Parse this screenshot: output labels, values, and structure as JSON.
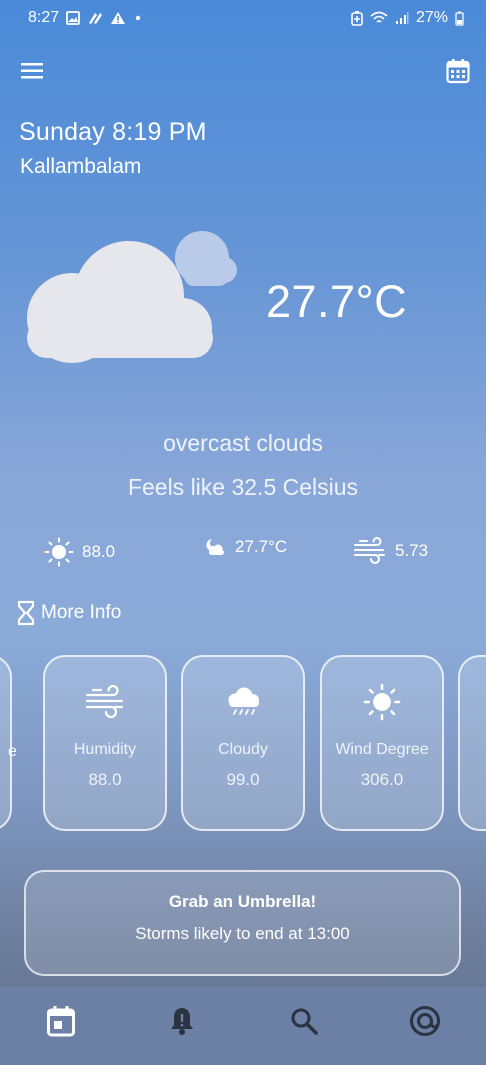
{
  "status_bar": {
    "time": "8:27",
    "battery": "27%",
    "icons_left": [
      "image-icon",
      "link-icon",
      "warning-icon",
      "dot-icon"
    ],
    "icons_right": [
      "battery-saver-icon",
      "wifi-icon",
      "signal-icon",
      "battery-icon"
    ]
  },
  "header": {
    "day_time": "Sunday 8:19 PM",
    "location": "Kallambalam"
  },
  "current": {
    "temperature": "27.7°C",
    "condition": "overcast clouds",
    "feels_like": "Feels like 32.5 Celsius",
    "weather_icon": "cloud-icon"
  },
  "stats": {
    "humidity_value": "88.0",
    "temp_value": "27.7°C",
    "wind_value": "5.73"
  },
  "more_info": {
    "label": "More Info"
  },
  "cards": [
    {
      "label": "Humidity",
      "value": "88.0",
      "icon": "wind-icon"
    },
    {
      "label": "Cloudy",
      "value": "99.0",
      "icon": "cloud-rain-icon"
    },
    {
      "label": "Wind Degree",
      "value": "306.0",
      "icon": "sun-icon"
    }
  ],
  "partial_left_text": "e",
  "alert": {
    "title": "Grab an Umbrella!",
    "text": "Storms likely to end at 13:00"
  },
  "nav": [
    "calendar-icon",
    "bell-alert-icon",
    "search-icon",
    "at-icon"
  ],
  "colors": {
    "bg_top": "#4a8ad8",
    "bg_bottom": "#5f6f8c",
    "nav_bg": "#6c7fa4",
    "cloud": "#e8e8ec",
    "cloud_back": "#b8c9e6"
  }
}
